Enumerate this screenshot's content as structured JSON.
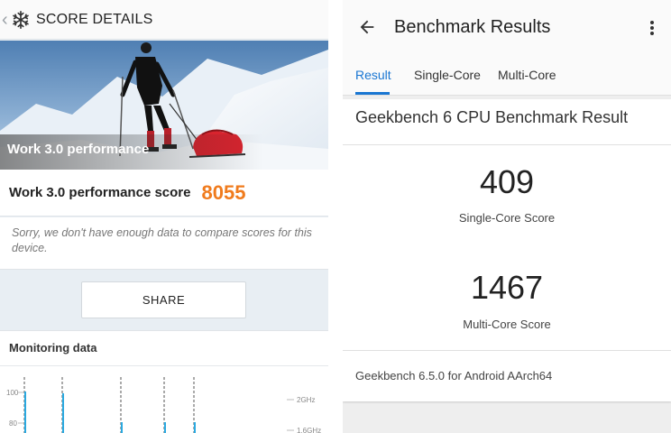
{
  "left": {
    "header_title": "SCORE DETAILS",
    "hero_caption": "Work 3.0 performance",
    "score_label": "Work 3.0 performance score",
    "score_value": "8055",
    "sorry_text": "Sorry, we don't have enough data to compare scores for this device.",
    "share_label": "SHARE",
    "monitoring_title": "Monitoring data",
    "monitor_axis_left": [
      "100",
      "80"
    ],
    "monitor_axis_right": [
      "2GHz",
      "1.6GHz"
    ]
  },
  "right": {
    "title": "Benchmark Results",
    "tabs": [
      {
        "label": "Result",
        "active": true
      },
      {
        "label": "Single-Core",
        "active": false
      },
      {
        "label": "Multi-Core",
        "active": false
      }
    ],
    "card_title": "Geekbench 6 CPU Benchmark Result",
    "single_core_score": "409",
    "single_core_label": "Single-Core Score",
    "multi_core_score": "1467",
    "multi_core_label": "Multi-Core Score",
    "footer": "Geekbench 6.5.0 for Android AArch64"
  },
  "colors": {
    "score_orange": "#f07b1d",
    "tab_blue": "#1976d2",
    "monitor_line_blue": "#2aa9e0"
  },
  "icons": [
    "chevron-left-icon",
    "snowflake-icon",
    "back-arrow-icon",
    "more-vert-icon"
  ]
}
